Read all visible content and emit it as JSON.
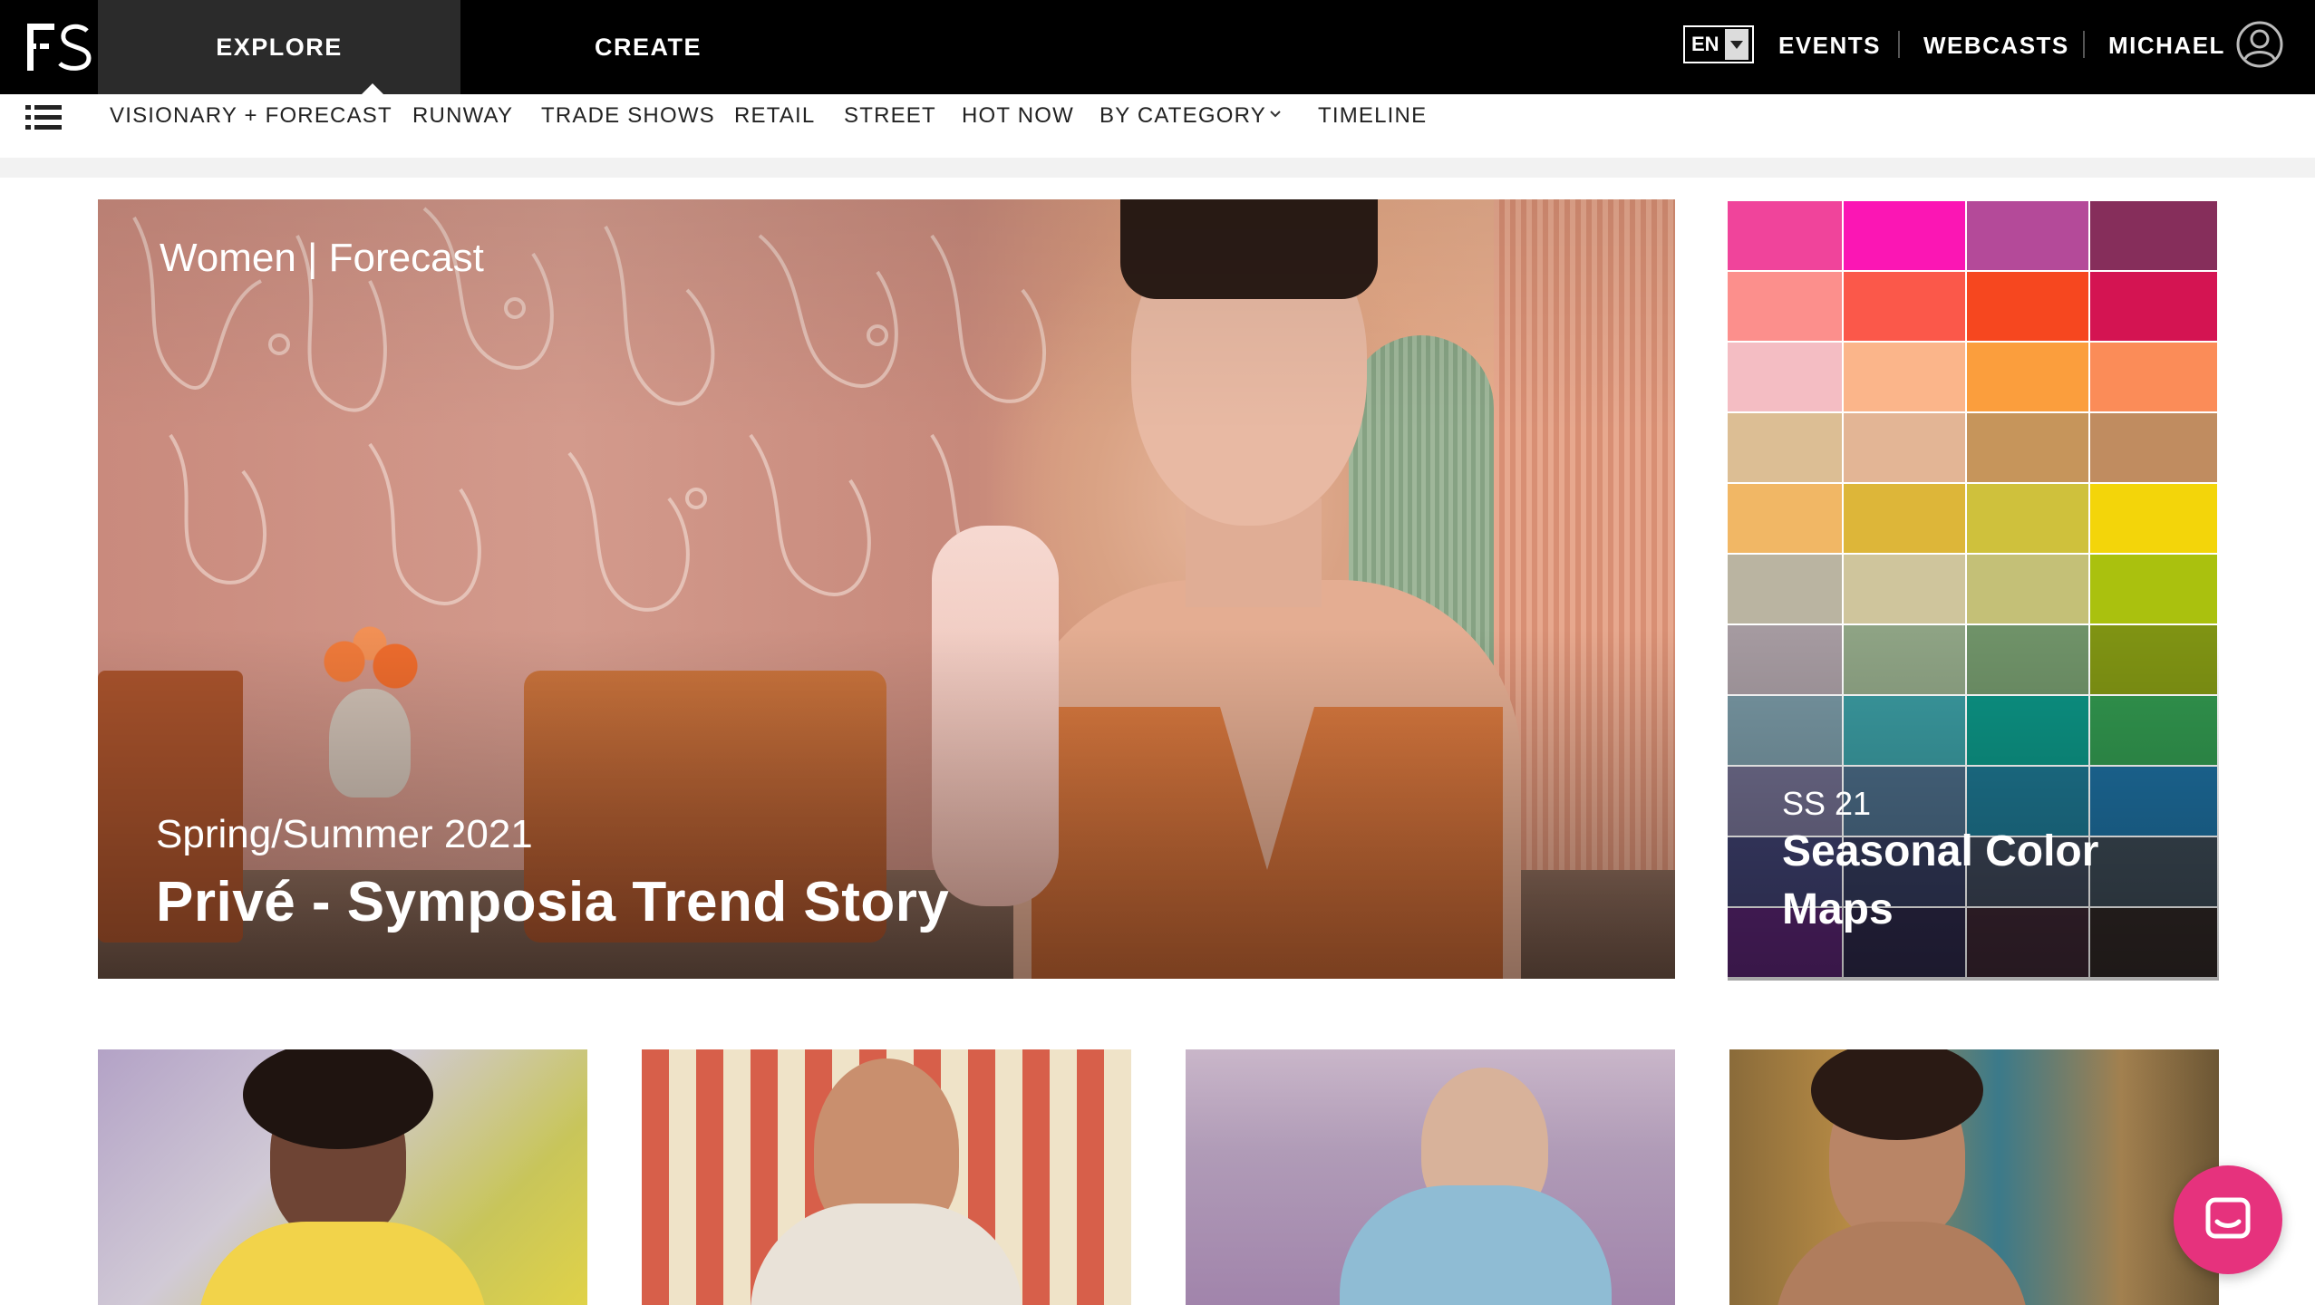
{
  "header": {
    "logo_text": "FS",
    "nav": [
      {
        "label": "EXPLORE",
        "active": true
      },
      {
        "label": "CREATE",
        "active": false
      }
    ],
    "language": "EN",
    "links": [
      "EVENTS",
      "WEBCASTS",
      "MICHAEL"
    ]
  },
  "subnav": {
    "items": [
      "VISIONARY + FORECAST",
      "RUNWAY",
      "TRADE SHOWS",
      "RETAIL",
      "STREET",
      "HOT NOW",
      "BY CATEGORY",
      "TIMELINE"
    ]
  },
  "hero": {
    "category": "Women | Forecast",
    "season": "Spring/Summer 2021",
    "title": "Privé - Symposia Trend Story"
  },
  "color_map_card": {
    "season": "SS 21",
    "title": "Seasonal Color Maps",
    "swatches": [
      [
        "#f0449b",
        "#fb16b4",
        "#b44a99",
        "#862e5b"
      ],
      [
        "#fc8f8c",
        "#fb584a",
        "#f6471f",
        "#d41452"
      ],
      [
        "#f4bdc3",
        "#fbb58a",
        "#fb9e3d",
        "#fb8c58"
      ],
      [
        "#dcbe94",
        "#e3b595",
        "#c6955b",
        "#c08c60"
      ],
      [
        "#f1b765",
        "#ddb639",
        "#cfc13c",
        "#f3d50a"
      ],
      [
        "#bab4a1",
        "#cfc59c",
        "#c4c077",
        "#aac10e"
      ],
      [
        "#a59aa0",
        "#8ea384",
        "#6f9268",
        "#7f9313"
      ],
      [
        "#7796a2",
        "#3a9aa0",
        "#0c9384",
        "#31964e"
      ],
      [
        "#6f6c8c",
        "#4a6a85",
        "#1d758f",
        "#1d6e9e"
      ],
      [
        "#3d3f6d",
        "#32395a",
        "#3b4455",
        "#3a4752"
      ],
      [
        "#56236e",
        "#2b2746",
        "#3a2531",
        "#2e2624"
      ]
    ]
  },
  "colors": {
    "topbar_bg": "#000000",
    "explore_bg": "#2b2b2b",
    "chat_button": "#e6327d"
  },
  "icons": [
    "logo",
    "chevron-down-icon",
    "menu-list-icon",
    "user-avatar-icon",
    "chat-icon"
  ]
}
